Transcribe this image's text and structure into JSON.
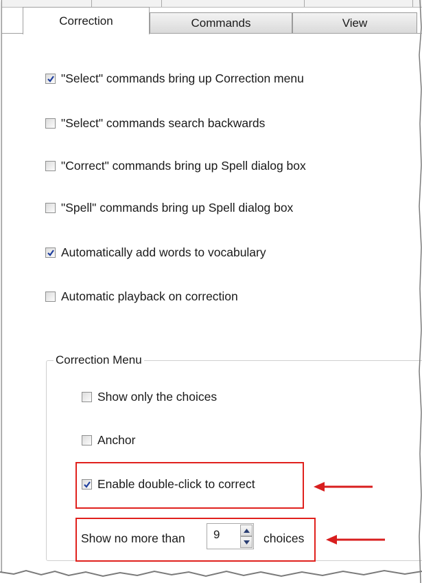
{
  "tabs": [
    {
      "label": "Correction",
      "active": true
    },
    {
      "label": "Commands",
      "active": false
    },
    {
      "label": "View",
      "active": false
    }
  ],
  "options": [
    {
      "label": "\"Select\" commands bring up Correction menu",
      "checked": true
    },
    {
      "label": "\"Select\" commands search backwards",
      "checked": false
    },
    {
      "label": "\"Correct\" commands bring up Spell dialog box",
      "checked": false
    },
    {
      "label": "\"Spell\" commands bring up Spell dialog box",
      "checked": false
    },
    {
      "label": "Automatically add words to vocabulary",
      "checked": true
    },
    {
      "label": "Automatic playback on correction",
      "checked": false
    }
  ],
  "correction_menu": {
    "title": "Correction Menu",
    "options": [
      {
        "label": "Show only the choices",
        "checked": false
      },
      {
        "label": "Anchor",
        "checked": false
      },
      {
        "label": "Enable double-click to correct",
        "checked": true
      }
    ],
    "max_choices": {
      "prefix": "Show no more than",
      "value": "9",
      "suffix": "choices"
    }
  },
  "colors": {
    "highlight_box": "#e0201c",
    "arrow": "#d81e1e",
    "checkmark": "#1f3f9e"
  }
}
